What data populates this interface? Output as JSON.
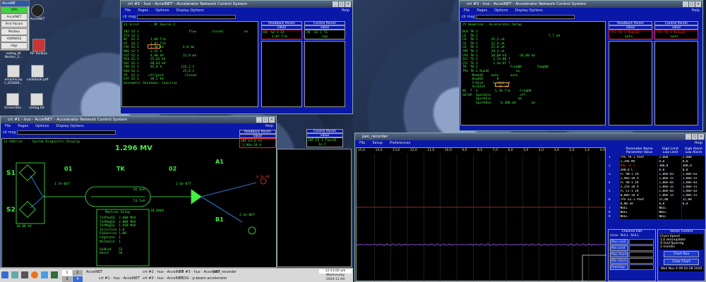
{
  "launcher": {
    "title": "AcceNE",
    "items": [
      "VMS",
      "AccelNET",
      "Prnt Param",
      "Mxiboo",
      "ASMWGE",
      "Hlgr"
    ]
  },
  "desktop": {
    "icons": [
      "AcceINET",
      "netlog_W Norton_3...",
      "RP Toolbox",
      "emailrecep t_201806...",
      "cookbook.pdf",
      "ScreenSho",
      "netlog.txt"
    ]
  },
  "win1": {
    "title": "crt #2 - hus - AccelNET - Accelerator Network Control System",
    "menus": [
      "File",
      "Pages",
      "Options",
      "Display Options"
    ],
    "help": "Help",
    "clr": "clr msg",
    "subtitle": "11 Srcs2      - RF Source 2",
    "lines": [
      "INJ S2-1                          flow        closed           on",
      "ITX S2-1",
      "",
      "RF  S2-1      1,09 Trm",
      "HT  S2-1      1,07 Trm",
      "",
      "FOC S2-1      3,40 kV          4,0 mA",
      "MAG S2-1      2,55 A",
      "EXT S2-1      4,68 kV          22,0 mA",
      "PEX S2-1     -25,65 kV",
      "OSC S2-1     -30,63 kV",
      "CRH S2-1      95,8 V          135,2 C",
      "OSH S2-1                       25,8 C",
      "",
      "TP  S2-1     off/post           closed",
      "EXT S2-1      28,5 kV",
      "",
      "Automatic Shutdown: inactive"
    ],
    "readback": {
      "header": "Readback Param",
      "sub": "value",
      "line1": "HX  S2-1 EX",
      "line2": "3,07 Trm"
    },
    "control": {
      "header": "Control Param",
      "sub": "value",
      "line1": "HV  S2-1 TS",
      "line2": "oop"
    }
  },
  "win2": {
    "title": "crt #3 - hus - AccelNET - Accelerator Network Control System",
    "menus": [
      "File",
      "Pages",
      "Options",
      "Display Options"
    ],
    "help": "Help",
    "clr": "clr msg",
    "subtitle": "25 Beamline - Accelerator Setup",
    "lines": [
      "BLH TK-1",
      "LE  TK-1                                     7,7 uA",
      "CH  TK-1       45,3 uA",
      "CX  TK-1       31,4 uA",
      "CO  TK-1       25,8 uA",
      "TMT TK-1       29,3 uA",
      "CPS TK-1       10,09 kV      -26,09 kV",
      "",
      "SCC TE-1        1,7e-06 T",
      "CCC TE-1        1,4e-07 T",
      "",
      "TM  TK-1                 FreqDK        TempDK",
      "",
      "TPS TK-1 RunSE              on",
      "     ModeSE    auto      auto",
      "     QuadSE       0",
      "     TrStat     1,2000 mA",
      "     ScnStat    -7,02 kV",
      "",
      "BS  T -1         5,50 Trm     FreqDK",
      "",
      "SETUP  SparkIns               off",
      "       SparkSin              ok",
      "       SparkOut     0,200 mA        ok"
    ],
    "readback": {
      "header": "Readback Param",
      "sub": "value",
      "line1": "TPS TK-1 ModeSE",
      "line2": "auto"
    },
    "control": {
      "header": "Control Param",
      "sub": "value",
      "line1": "TPS TK-1 ModeSE",
      "line2": "auto"
    }
  },
  "win3": {
    "title": "crt #1 - hus - AccelNET - Accelerator Network Control System",
    "menus": [
      "File",
      "Pages",
      "Options",
      "Display Options"
    ],
    "help": "Help",
    "clr": "clr msg",
    "subtitle": "11 EbDrive   - System Diagnostic Display",
    "energy": "1.296 MV",
    "labels": {
      "s1": "S1",
      "s2": "S2",
      "tk": "TK",
      "o1": "01",
      "o2": "02",
      "a1": "A1",
      "b1": "B1"
    },
    "values": [
      "1.7e-06T",
      "2.6e-07T",
      "05.0uA",
      "53.5uA",
      "2.3e-06T",
      "18,09kV",
      "10,00 kV",
      "0.3e-06"
    ],
    "machine": {
      "title": "Machine Setup",
      "rows": [
        [
          "TotPanEQ",
          "2,000 MeV"
        ],
        [
          "TotMagEQ",
          "2,800 MeV"
        ],
        [
          "TotMagTp",
          "1,950 MeV"
        ],
        [
          "Injection",
          "1,0"
        ],
        [
          "Expansion",
          "1,00"
        ],
        [
          "ChgState",
          "1"
        ],
        [
          "MolHeInt",
          "1"
        ],
        [
          "",
          "",
          ""
        ],
        [
          "GndEnd",
          "53"
        ],
        [
          "Decel",
          "56"
        ]
      ]
    },
    "readback": {
      "header": "Readback Param",
      "sub": "value",
      "line1": "INT E5-6 CX",
      "line2": "3,96e-10 A"
    },
    "control": {
      "header": "Control Param",
      "sub": "value",
      "line1": "INT E5-1 TaucSE",
      "line2": "1e-7"
    }
  },
  "recorder": {
    "title": "pen_recorder",
    "menus": [
      "File",
      "Setup",
      "Preferences"
    ],
    "help": "Help",
    "xticks": [
      "15,0",
      "14,0",
      "13,0",
      "12,0",
      "11,0",
      "10,0",
      "9,0",
      "8,0",
      "7,0",
      "6,0",
      "5,0",
      "4,0",
      "3,0",
      "2,0",
      "1,0",
      "0,0"
    ],
    "paramHeaders": [
      "Parameter Name",
      "High Limit",
      "High Alarm"
    ],
    "paramSub": [
      "Parameter Value",
      "Low Limit",
      "Low Alarm"
    ],
    "params": [
      [
        "1",
        "TPS TK-1 PSet",
        "2,000",
        "2,000"
      ],
      [
        "",
        "1,296 MV",
        "0,0",
        "0,0"
      ],
      [
        "2",
        "RMS TK-1",
        "300,0",
        "300,0"
      ],
      [
        "",
        "200,0 C",
        "0,0",
        "0,0"
      ],
      [
        "3",
        "FC  AN-1 IR",
        "1,00e-03",
        "1,00e-03"
      ],
      [
        "",
        "1,96e-10 A",
        "1,00e-15",
        "1,00e-15"
      ],
      [
        "4",
        "FC  A0-1 IR",
        "1,00e-03",
        "1,00e-03"
      ],
      [
        "",
        "3,25e-10 A",
        "1,00e-15",
        "1,00e-15"
      ],
      [
        "5",
        "FC  C1-1 IR",
        "1,00e-03",
        "1,00e-03"
      ],
      [
        "",
        "0,00e-10 A",
        "1,00e-15",
        "1,00e-15"
      ],
      [
        "6",
        "TPS S2-1 PSet",
        "15,00",
        "15,00"
      ],
      [
        "",
        "0,00 uA",
        "0,0",
        "0,0"
      ],
      [
        "7",
        "NULL",
        "NULL",
        ""
      ],
      [
        "8",
        "NULL",
        "NULL",
        ""
      ],
      [
        "9",
        "NULL",
        "NULL",
        ""
      ]
    ],
    "channel": {
      "title": "Channel Edit",
      "row": [
        "show",
        "NULL",
        "NULL"
      ],
      "fields": [
        "Max Limit",
        "Min Limit",
        "Max Alarm",
        "Min Alarm",
        "DataSign"
      ]
    },
    "vector": {
      "title": "Vector Control",
      "chartSpeed": "Chart Speed",
      "speedVal": "1,0 secs/update",
      "grid": "X Grid Spacing",
      "gridVal": "1 min/div",
      "chartRun": "Chart Run",
      "clearChart": "Clear Chart",
      "date": "Wed Nov  4 09:52:58 2020"
    }
  },
  "taskbar": {
    "pager": [
      "1",
      "2",
      "3",
      "4"
    ],
    "items": [
      "AcceINET",
      "crt #2 - hus - AcceINET",
      "crt #3 - hus - AcceINET",
      "pen_recorder",
      "crt #1 - hus - AcceINET",
      "crt #3 - hus - AcceINET",
      "ELOG - p-beam accelerator"
    ],
    "time": "12:53:00 am",
    "day": "Wednesday",
    "date": "2020-11-04"
  }
}
